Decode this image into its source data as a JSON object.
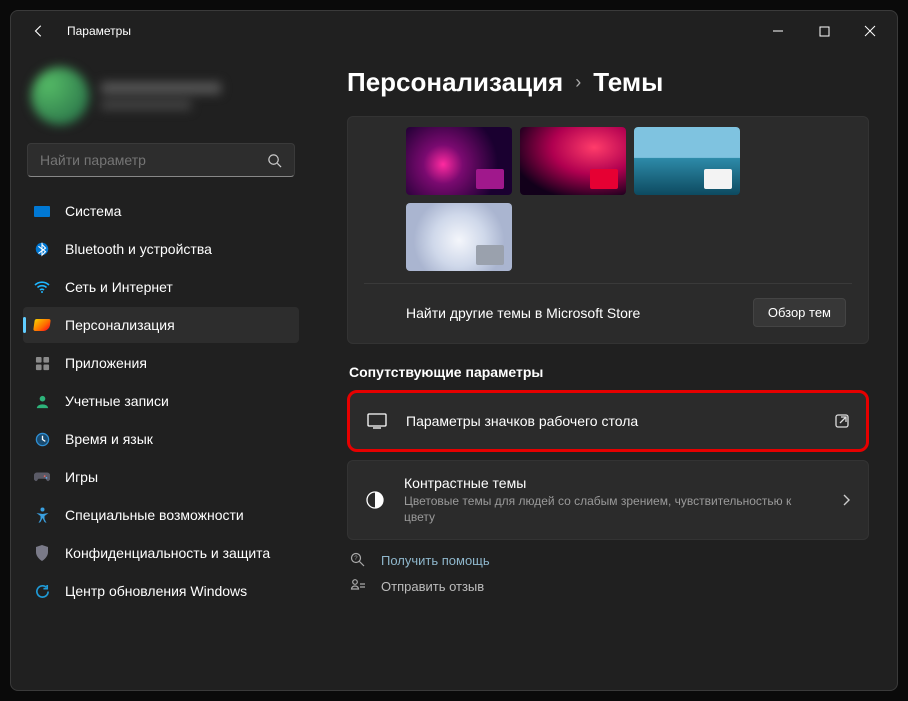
{
  "window": {
    "title": "Параметры"
  },
  "search": {
    "placeholder": "Найти параметр"
  },
  "sidebar": {
    "items": [
      {
        "label": "Система"
      },
      {
        "label": "Bluetooth и устройства"
      },
      {
        "label": "Сеть и Интернет"
      },
      {
        "label": "Персонализация"
      },
      {
        "label": "Приложения"
      },
      {
        "label": "Учетные записи"
      },
      {
        "label": "Время и язык"
      },
      {
        "label": "Игры"
      },
      {
        "label": "Специальные возможности"
      },
      {
        "label": "Конфиденциальность и защита"
      },
      {
        "label": "Центр обновления Windows"
      }
    ]
  },
  "breadcrumb": {
    "root": "Персонализация",
    "current": "Темы"
  },
  "store": {
    "text": "Найти другие темы в Microsoft Store",
    "button": "Обзор тем"
  },
  "related": {
    "heading": "Сопутствующие параметры",
    "desktop_icons": {
      "title": "Параметры значков рабочего стола"
    },
    "contrast": {
      "title": "Контрастные темы",
      "desc": "Цветовые темы для людей со слабым зрением, чувствительностью к цвету"
    }
  },
  "footer": {
    "help": "Получить помощь",
    "feedback": "Отправить отзыв"
  }
}
